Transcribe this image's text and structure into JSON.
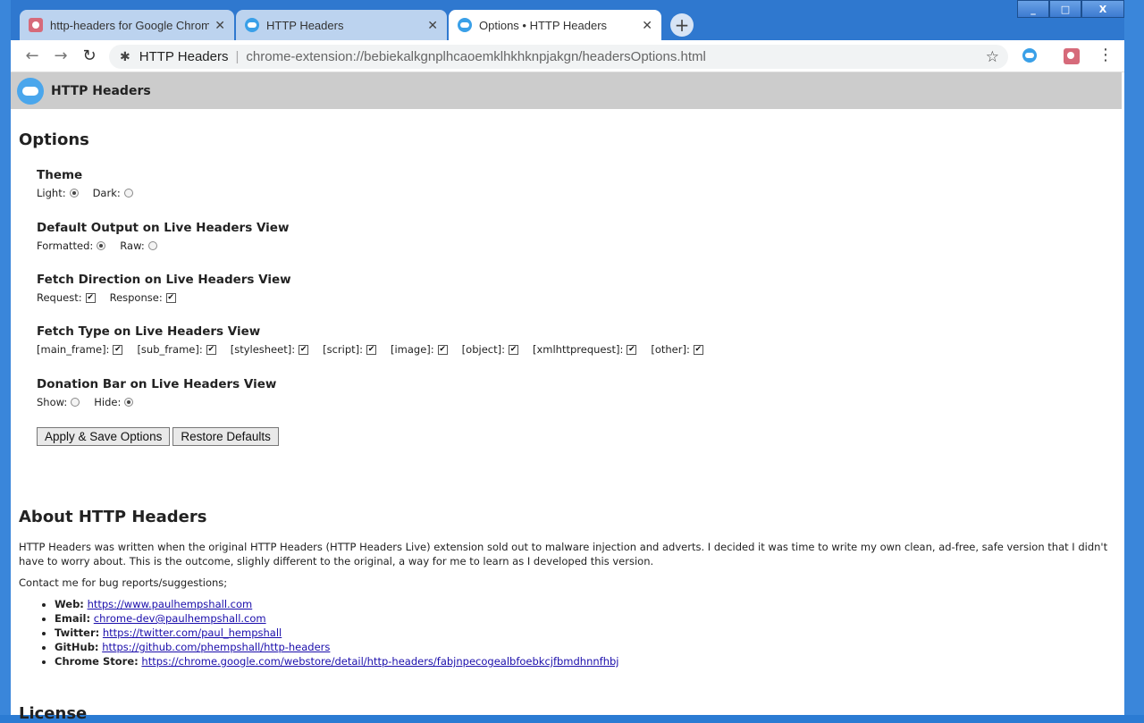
{
  "browser": {
    "tabs": [
      {
        "title": "http-headers for Google Chrome",
        "favicon": "github-icon",
        "active": false
      },
      {
        "title": "HTTP Headers",
        "favicon": "cloud-icon",
        "active": false
      },
      {
        "title": "Options • HTTP Headers",
        "favicon": "cloud-icon",
        "active": true
      }
    ],
    "close_glyph": "✕",
    "new_tab_glyph": "+",
    "omnibox": {
      "site_name": "HTTP Headers",
      "url": "chrome-extension://bebiekalkgnplhcaoemklhkhknpjakgn/headersOptions.html"
    },
    "window_buttons": {
      "minimize": "_",
      "maximize": "□",
      "close": "X"
    }
  },
  "extension": {
    "header_title": "HTTP Headers",
    "accent": "#4aa6ec"
  },
  "options": {
    "heading": "Options",
    "theme": {
      "title": "Theme",
      "items": [
        {
          "label": "Light:",
          "checked": true
        },
        {
          "label": "Dark:",
          "checked": false
        }
      ]
    },
    "output": {
      "title": "Default Output on Live Headers View",
      "items": [
        {
          "label": "Formatted:",
          "checked": true
        },
        {
          "label": "Raw:",
          "checked": false
        }
      ]
    },
    "direction": {
      "title": "Fetch Direction on Live Headers View",
      "items": [
        {
          "label": "Request:",
          "checked": true
        },
        {
          "label": "Response:",
          "checked": true
        }
      ]
    },
    "fetch_type": {
      "title": "Fetch Type on Live Headers View",
      "items": [
        {
          "label": "[main_frame]:",
          "checked": true
        },
        {
          "label": "[sub_frame]:",
          "checked": true
        },
        {
          "label": "[stylesheet]:",
          "checked": true
        },
        {
          "label": "[script]:",
          "checked": true
        },
        {
          "label": "[image]:",
          "checked": true
        },
        {
          "label": "[object]:",
          "checked": true
        },
        {
          "label": "[xmlhttprequest]:",
          "checked": true
        },
        {
          "label": "[other]:",
          "checked": true
        }
      ]
    },
    "donation": {
      "title": "Donation Bar on Live Headers View",
      "items": [
        {
          "label": "Show:",
          "checked": false
        },
        {
          "label": "Hide:",
          "checked": true
        }
      ]
    },
    "apply_label": "Apply & Save Options",
    "restore_label": "Restore Defaults"
  },
  "about": {
    "heading": "About HTTP Headers",
    "paragraph": "HTTP Headers was written when the original HTTP Headers (HTTP Headers Live) extension sold out to malware injection and adverts. I decided it was time to write my own clean, ad-free, safe version that I didn't have to worry about. This is the outcome, slighly different to the original, a way for me to learn as I developed this version.",
    "contact_intro": "Contact me for bug reports/suggestions;",
    "contacts": [
      {
        "label": "Web:",
        "link": "https://www.paulhempshall.com"
      },
      {
        "label": "Email:",
        "link": "chrome-dev@paulhempshall.com"
      },
      {
        "label": "Twitter:",
        "link": "https://twitter.com/paul_hempshall"
      },
      {
        "label": "GitHub:",
        "link": "https://github.com/phempshall/http-headers"
      },
      {
        "label": "Chrome Store:",
        "link": "https://chrome.google.com/webstore/detail/http-headers/fabjnpecogealbfoebkcjfbmdhnnfhbj"
      }
    ]
  },
  "license": {
    "heading": "License"
  }
}
